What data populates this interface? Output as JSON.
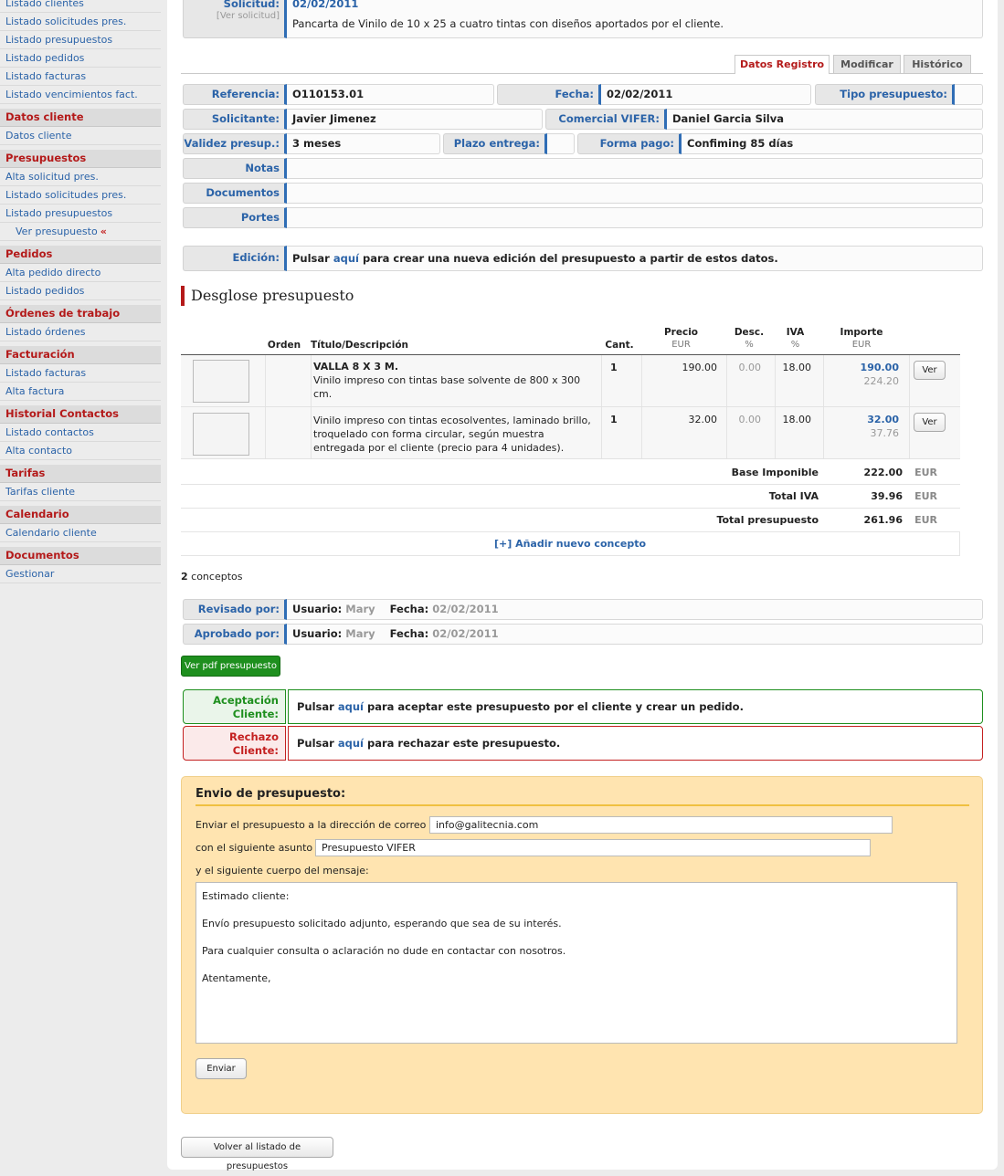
{
  "sidebar": {
    "top_links": [
      "Listado clientes",
      "Listado solicitudes pres.",
      "Listado presupuestos",
      "Listado pedidos",
      "Listado facturas",
      "Listado vencimientos fact."
    ],
    "datos_cliente": {
      "title": "Datos cliente",
      "links": [
        "Datos cliente"
      ]
    },
    "presupuestos": {
      "title": "Presupuestos",
      "links": [
        "Alta solicitud pres.",
        "Listado solicitudes pres.",
        "Listado presupuestos"
      ],
      "current": "Ver presupuesto",
      "current_mark": "«"
    },
    "pedidos": {
      "title": "Pedidos",
      "links": [
        "Alta pedido directo",
        "Listado pedidos"
      ]
    },
    "ordenes": {
      "title": "Órdenes de trabajo",
      "links": [
        "Listado órdenes"
      ]
    },
    "facturacion": {
      "title": "Facturación",
      "links": [
        "Listado facturas",
        "Alta factura"
      ]
    },
    "historial": {
      "title": "Historial Contactos",
      "links": [
        "Listado contactos",
        "Alta contacto"
      ]
    },
    "tarifas": {
      "title": "Tarifas",
      "links": [
        "Tarifas cliente"
      ]
    },
    "calendario": {
      "title": "Calendario",
      "links": [
        "Calendario cliente"
      ]
    },
    "documentos": {
      "title": "Documentos",
      "links": [
        "Gestionar"
      ]
    }
  },
  "solicitud": {
    "label": "Solicitud:",
    "sublabel": "[Ver solicitud]",
    "date": "02/02/2011",
    "text": "Pancarta de Vinilo de 10 x 25 a cuatro tintas con diseños aportados por el cliente."
  },
  "tabs": {
    "datos": "Datos Registro",
    "modificar": "Modificar",
    "historico": "Histórico"
  },
  "registro": {
    "referencia": {
      "label": "Referencia:",
      "value": "O110153.01"
    },
    "fecha": {
      "label": "Fecha:",
      "value": "02/02/2011"
    },
    "tipo": {
      "label": "Tipo presupuesto:",
      "value": ""
    },
    "solicitante": {
      "label": "Solicitante:",
      "value": "Javier Jimenez"
    },
    "comercial": {
      "label": "Comercial VIFER:",
      "value": "Daniel Garcia Silva"
    },
    "validez": {
      "label": "Validez presup.:",
      "value": "3 meses"
    },
    "plazo": {
      "label": "Plazo entrega:",
      "value": ""
    },
    "forma_pago": {
      "label": "Forma pago:",
      "value": "Confiming 85 días"
    },
    "notas": {
      "label": "Notas",
      "value": ""
    },
    "documentos": {
      "label": "Documentos",
      "value": ""
    },
    "portes": {
      "label": "Portes",
      "value": ""
    },
    "edicion": {
      "label": "Edición:",
      "pre": "Pulsar ",
      "link": "aquí",
      "post": " para crear una nueva edición del presupuesto a partir de estos datos."
    }
  },
  "desglose": {
    "title": "Desglose presupuesto",
    "headers": {
      "orden": "Orden",
      "titulo": "Título/Descripción",
      "cant": "Cant.",
      "precio": "Precio",
      "precio_unit": "EUR",
      "desc": "Desc.",
      "desc_unit": "%",
      "iva": "IVA",
      "iva_unit": "%",
      "importe": "Importe",
      "importe_unit": "EUR"
    },
    "items": [
      {
        "title": "VALLA 8 X 3 M.",
        "desc": "Vinilo impreso con tintas base solvente de 800 x 300 cm.",
        "cant": "1",
        "precio": "190.00",
        "descuento": "0.00",
        "iva": "18.00",
        "importe": "190.00",
        "importe_iva": "224.20",
        "btn": "Ver"
      },
      {
        "title": "",
        "desc": "Vinilo impreso con tintas ecosolventes, laminado brillo, troquelado con forma circular, según muestra entregada por el cliente (precio para 4 unidades).",
        "cant": "1",
        "precio": "32.00",
        "descuento": "0.00",
        "iva": "18.00",
        "importe": "32.00",
        "importe_iva": "37.76",
        "btn": "Ver"
      }
    ],
    "totals": [
      {
        "label": "Base Imponible",
        "value": "222.00",
        "currency": "EUR"
      },
      {
        "label": "Total IVA",
        "value": "39.96",
        "currency": "EUR"
      },
      {
        "label": "Total presupuesto",
        "value": "261.96",
        "currency": "EUR"
      }
    ],
    "add_link": "[+] Añadir nuevo concepto",
    "count": "2",
    "count_label": " conceptos"
  },
  "revisado": {
    "label": "Revisado por:",
    "user_label": "Usuario:",
    "user": "Mary",
    "date_label": "Fecha:",
    "date": "02/02/2011"
  },
  "aprobado": {
    "label": "Aprobado por:",
    "user_label": "Usuario:",
    "user": "Mary",
    "date_label": "Fecha:",
    "date": "02/02/2011"
  },
  "pdf_button": "Ver pdf presupuesto",
  "aceptacion": {
    "label1": "Aceptación",
    "label2": "Cliente:",
    "pre": "Pulsar ",
    "link": "aquí",
    "post": " para aceptar este presupuesto por el cliente y crear un pedido.",
    "color": "#1a8a1a"
  },
  "rechazo": {
    "label1": "Rechazo",
    "label2": "Cliente:",
    "pre": "Pulsar ",
    "link": "aquí",
    "post": " para rechazar este presupuesto.",
    "color": "#c42020"
  },
  "envio": {
    "title": "Envio de presupuesto:",
    "email_label": "Enviar el presupuesto a la dirección de correo",
    "email": "info@galitecnia.com",
    "subject_label": "con el siguiente asunto",
    "subject": "Presupuesto VIFER",
    "body_label": "y el siguiente cuerpo del mensaje:",
    "body": [
      "Estimado cliente:",
      "Envío presupuesto solicitado adjunto, esperando que sea de su interés.",
      "Para cualquier consulta o aclaración no dude en contactar con nosotros.",
      "Atentamente,"
    ],
    "send_button": "Enviar"
  },
  "back_button": "Volver al listado de presupuestos",
  "colors": {
    "accent_blue": "#2f6db5",
    "brand_red": "#b41a1a",
    "green": "#1a8a1a",
    "envio_bg": "#ffe4b0"
  }
}
